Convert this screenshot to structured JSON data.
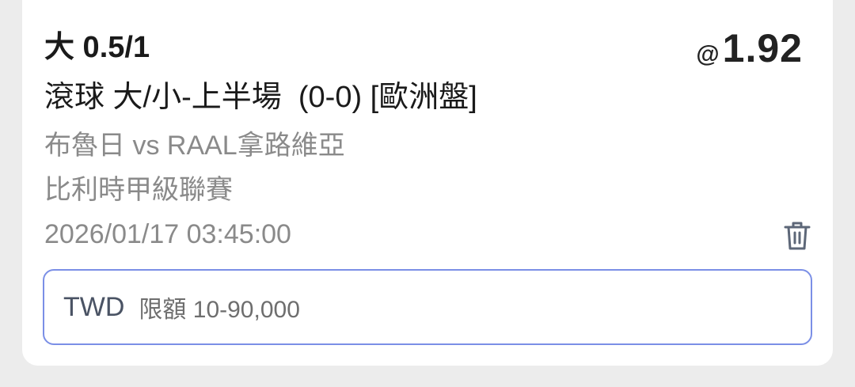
{
  "bet": {
    "selection": "大 0.5/1",
    "odds_prefix": "@",
    "odds": "1.92",
    "market": "滾球 大/小-上半場  (0-0) [歐洲盤]",
    "teams": "布魯日 vs RAAL拿路維亞",
    "league": "比利時甲級聯賽",
    "datetime": "2026/01/17 03:45:00"
  },
  "stake": {
    "currency": "TWD",
    "limit_text": "限額 10-90,000"
  },
  "icons": {
    "delete": "trash-icon"
  },
  "colors": {
    "input_border": "#7b8fe6",
    "muted_text": "#8a8a8a",
    "card_bg": "#ffffff",
    "page_bg": "#ececec"
  }
}
